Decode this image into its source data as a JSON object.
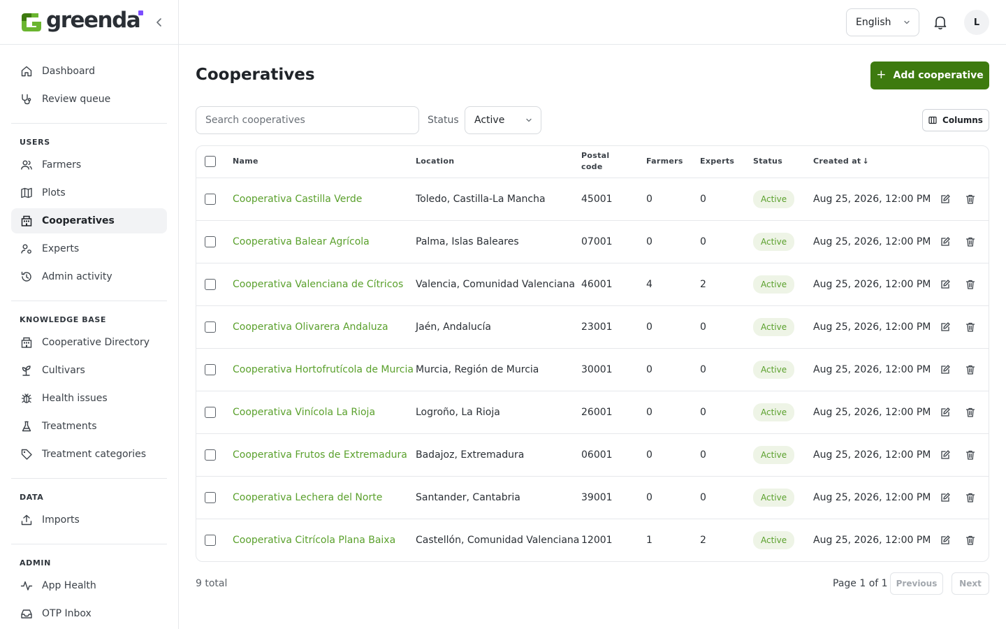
{
  "brand": {
    "name": "greenda"
  },
  "header": {
    "language": "English",
    "avatar_initial": "L"
  },
  "sidebar": {
    "main_items": [
      {
        "label": "Dashboard",
        "icon": "home-icon"
      },
      {
        "label": "Review queue",
        "icon": "stethoscope-icon"
      }
    ],
    "sections": [
      {
        "heading": "USERS",
        "items": [
          {
            "label": "Farmers",
            "icon": "users-icon"
          },
          {
            "label": "Plots",
            "icon": "map-icon"
          },
          {
            "label": "Cooperatives",
            "icon": "building-icon",
            "active": true
          },
          {
            "label": "Experts",
            "icon": "user-cog-icon"
          },
          {
            "label": "Admin activity",
            "icon": "history-icon"
          }
        ]
      },
      {
        "heading": "KNOWLEDGE BASE",
        "items": [
          {
            "label": "Cooperative Directory",
            "icon": "building-icon"
          },
          {
            "label": "Cultivars",
            "icon": "sprout-icon"
          },
          {
            "label": "Health issues",
            "icon": "bug-icon"
          },
          {
            "label": "Treatments",
            "icon": "flask-icon"
          },
          {
            "label": "Treatment categories",
            "icon": "tag-icon"
          }
        ]
      },
      {
        "heading": "DATA",
        "items": [
          {
            "label": "Imports",
            "icon": "upload-icon"
          }
        ]
      },
      {
        "heading": "ADMIN",
        "items": [
          {
            "label": "App Health",
            "icon": "activity-icon"
          },
          {
            "label": "OTP Inbox",
            "icon": "inbox-icon"
          }
        ]
      }
    ]
  },
  "page": {
    "title": "Cooperatives",
    "add_button": "Add cooperative",
    "search_placeholder": "Search cooperatives",
    "status_label": "Status",
    "status_value": "Active",
    "columns_button": "Columns"
  },
  "table": {
    "headers": {
      "name": "Name",
      "location": "Location",
      "postal_line1": "Postal",
      "postal_line2": "code",
      "farmers": "Farmers",
      "experts": "Experts",
      "status": "Status",
      "created": "Created at"
    },
    "rows": [
      {
        "name": "Cooperativa Castilla Verde",
        "location": "Toledo, Castilla-La Mancha",
        "postal": "45001",
        "farmers": "0",
        "experts": "0",
        "status": "Active",
        "created": "Aug 25, 2026, 12:00 PM"
      },
      {
        "name": "Cooperativa Balear Agrícola",
        "location": "Palma, Islas Baleares",
        "postal": "07001",
        "farmers": "0",
        "experts": "0",
        "status": "Active",
        "created": "Aug 25, 2026, 12:00 PM"
      },
      {
        "name": "Cooperativa Valenciana de Cítricos",
        "location": "Valencia, Comunidad Valenciana",
        "postal": "46001",
        "farmers": "4",
        "experts": "2",
        "status": "Active",
        "created": "Aug 25, 2026, 12:00 PM"
      },
      {
        "name": "Cooperativa Olivarera Andaluza",
        "location": "Jaén, Andalucía",
        "postal": "23001",
        "farmers": "0",
        "experts": "0",
        "status": "Active",
        "created": "Aug 25, 2026, 12:00 PM"
      },
      {
        "name": "Cooperativa Hortofrutícola de Murcia",
        "location": "Murcia, Región de Murcia",
        "postal": "30001",
        "farmers": "0",
        "experts": "0",
        "status": "Active",
        "created": "Aug 25, 2026, 12:00 PM"
      },
      {
        "name": "Cooperativa Vinícola La Rioja",
        "location": "Logroño, La Rioja",
        "postal": "26001",
        "farmers": "0",
        "experts": "0",
        "status": "Active",
        "created": "Aug 25, 2026, 12:00 PM"
      },
      {
        "name": "Cooperativa Frutos de Extremadura",
        "location": "Badajoz, Extremadura",
        "postal": "06001",
        "farmers": "0",
        "experts": "0",
        "status": "Active",
        "created": "Aug 25, 2026, 12:00 PM"
      },
      {
        "name": "Cooperativa Lechera del Norte",
        "location": "Santander, Cantabria",
        "postal": "39001",
        "farmers": "0",
        "experts": "0",
        "status": "Active",
        "created": "Aug 25, 2026, 12:00 PM"
      },
      {
        "name": "Cooperativa Citrícola Plana Baixa",
        "location": "Castellón, Comunidad Valenciana",
        "postal": "12001",
        "farmers": "1",
        "experts": "2",
        "status": "Active",
        "created": "Aug 25, 2026, 12:00 PM"
      }
    ]
  },
  "footer": {
    "total": "9 total",
    "page_info": "Page 1 of 1",
    "prev": "Previous",
    "next": "Next"
  },
  "colors": {
    "brand_green": "#3d7a0f",
    "link_green": "#5aa02c",
    "badge_bg": "#eef4e6",
    "accent_purple": "#7c4dff"
  }
}
